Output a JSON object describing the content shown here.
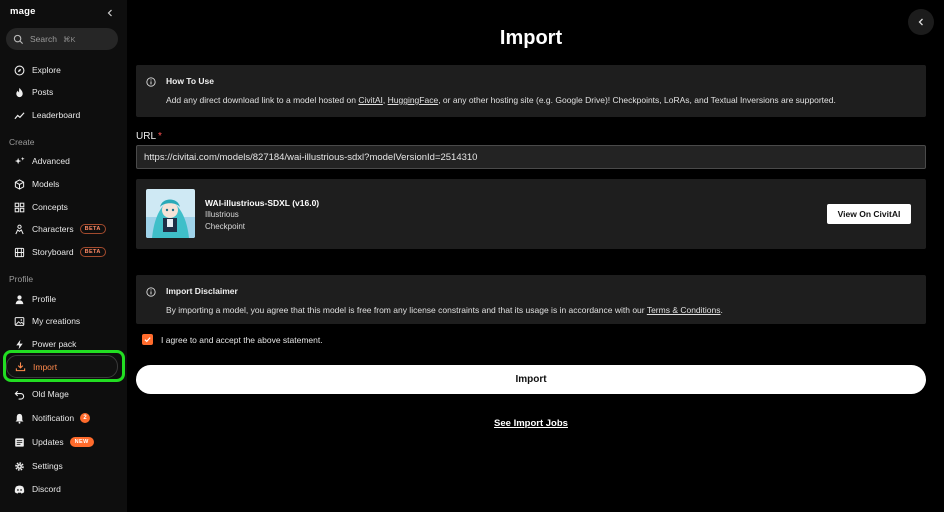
{
  "app": {
    "logo": "mage"
  },
  "search": {
    "placeholder": "Search",
    "shortcut": "⌘K"
  },
  "sidebar": {
    "items_top": [
      {
        "label": "Explore",
        "icon": "compass-icon"
      },
      {
        "label": "Posts",
        "icon": "flame-icon"
      },
      {
        "label": "Leaderboard",
        "icon": "chart-icon"
      }
    ],
    "create_section": "Create",
    "create_items": [
      {
        "label": "Advanced",
        "icon": "sparkles-icon"
      },
      {
        "label": "Models",
        "icon": "cube-icon"
      },
      {
        "label": "Concepts",
        "icon": "grid-icon"
      },
      {
        "label": "Characters",
        "icon": "people-icon",
        "badge": "BETA"
      },
      {
        "label": "Storyboard",
        "icon": "film-icon",
        "badge": "BETA"
      }
    ],
    "profile_section": "Profile",
    "profile_items": [
      {
        "label": "Profile",
        "icon": "user-icon"
      },
      {
        "label": "My creations",
        "icon": "image-icon"
      },
      {
        "label": "Power pack",
        "icon": "bolt-icon"
      },
      {
        "label": "Import",
        "icon": "download-icon",
        "active": true
      },
      {
        "label": "Old Mage",
        "icon": "undo-icon"
      },
      {
        "label": "Notification",
        "icon": "bell-icon",
        "count": "2"
      },
      {
        "label": "Updates",
        "icon": "news-icon",
        "badge": "NEW"
      },
      {
        "label": "Settings",
        "icon": "gear-icon"
      },
      {
        "label": "Discord",
        "icon": "discord-icon"
      }
    ]
  },
  "main": {
    "title": "Import",
    "how_to": {
      "title": "How To Use",
      "text_pre": "Add any direct download link to a model hosted on ",
      "link1": "CivitAI",
      "sep": ", ",
      "link2": "HuggingFace",
      "text_post": ", or any other hosting site (e.g. Google Drive)! Checkpoints, LoRAs, and Textual Inversions are supported."
    },
    "url": {
      "label": "URL",
      "required": "*",
      "value": "https://civitai.com/models/827184/wai-illustrious-sdxl?modelVersionId=2514310"
    },
    "model": {
      "name": "WAI-illustrious-SDXL (v16.0)",
      "base": "Illustrious",
      "type": "Checkpoint",
      "view_button": "View On CivitAI"
    },
    "disclaimer": {
      "title": "Import Disclaimer",
      "text_pre": "By importing a model, you agree that this model is free from any license constraints and that its usage is in accordance with our ",
      "link": "Terms & Conditions",
      "text_post": "."
    },
    "agree_label": "I agree to and accept the above statement.",
    "agree_checked": true,
    "import_button": "Import",
    "jobs_link": "See Import Jobs"
  },
  "colors": {
    "accent": "#ff6b2c",
    "highlight": "#22dd22",
    "panel": "#1e1e1e"
  }
}
